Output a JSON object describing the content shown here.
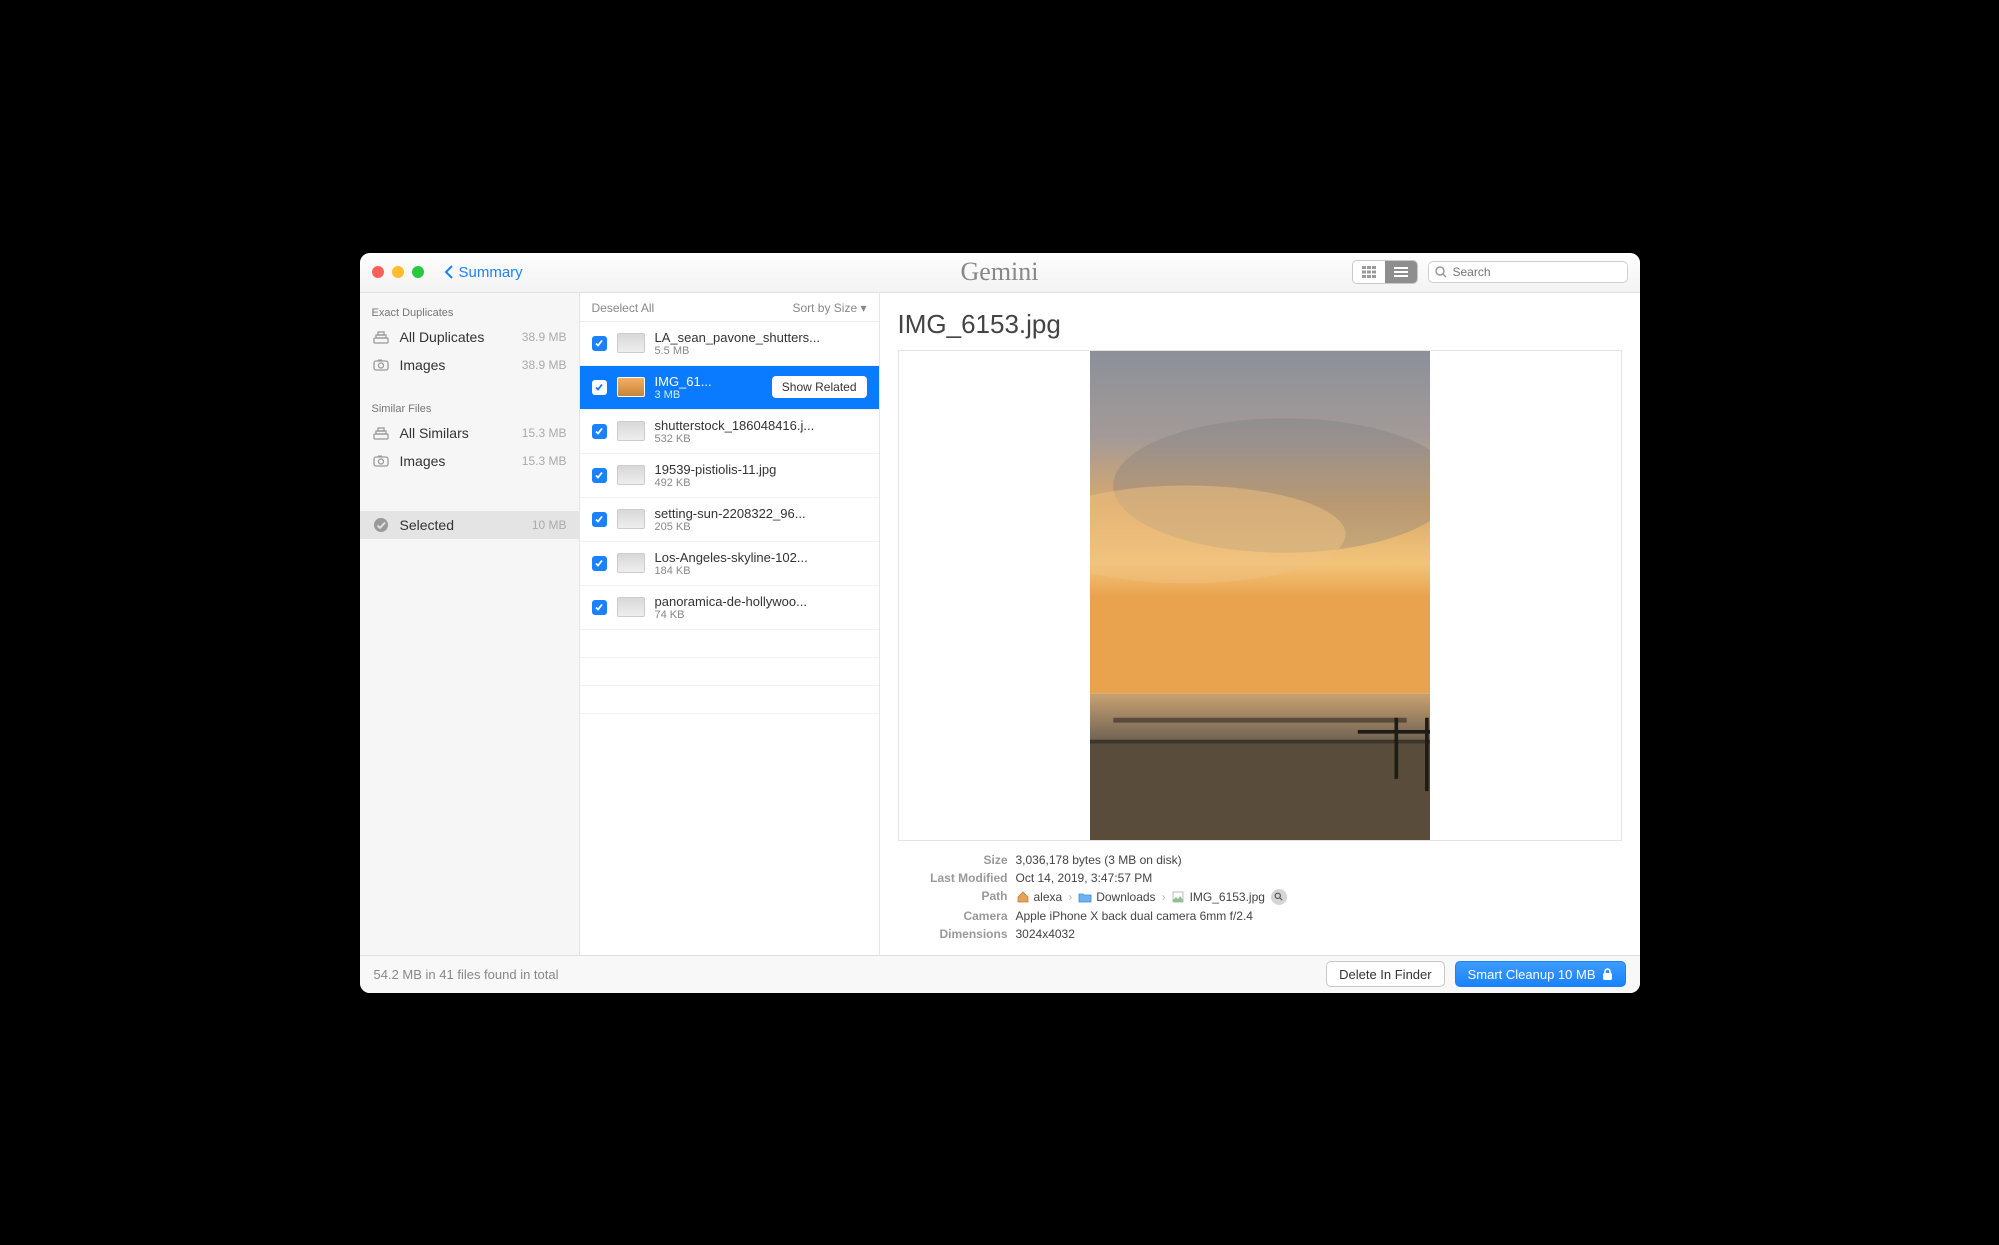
{
  "titlebar": {
    "back_label": "Summary",
    "app_logo_text": "Gemini",
    "search_placeholder": "Search"
  },
  "sidebar": {
    "sections": [
      {
        "title": "Exact Duplicates",
        "items": [
          {
            "icon": "stack",
            "label": "All Duplicates",
            "size": "38.9 MB"
          },
          {
            "icon": "camera",
            "label": "Images",
            "size": "38.9 MB"
          }
        ]
      },
      {
        "title": "Similar Files",
        "items": [
          {
            "icon": "stack",
            "label": "All Similars",
            "size": "15.3 MB"
          },
          {
            "icon": "camera",
            "label": "Images",
            "size": "15.3 MB"
          }
        ]
      }
    ],
    "selected": {
      "icon": "check-circle",
      "label": "Selected",
      "size": "10 MB"
    }
  },
  "filelist": {
    "deselect_label": "Deselect All",
    "sort_label": "Sort by Size ▾",
    "show_related_label": "Show Related",
    "rows": [
      {
        "name": "LA_sean_pavone_shutters...",
        "size": "5.5 MB",
        "checked": true,
        "selected": false
      },
      {
        "name": "IMG_61...",
        "size": "3 MB",
        "checked": true,
        "selected": true
      },
      {
        "name": "shutterstock_186048416.j...",
        "size": "532 KB",
        "checked": true,
        "selected": false
      },
      {
        "name": "19539-pistiolis-11.jpg",
        "size": "492 KB",
        "checked": true,
        "selected": false
      },
      {
        "name": "setting-sun-2208322_96...",
        "size": "205 KB",
        "checked": true,
        "selected": false
      },
      {
        "name": "Los-Angeles-skyline-102...",
        "size": "184 KB",
        "checked": true,
        "selected": false
      },
      {
        "name": "panoramica-de-hollywoo...",
        "size": "74 KB",
        "checked": true,
        "selected": false
      }
    ]
  },
  "preview": {
    "title": "IMG_6153.jpg",
    "details": {
      "size_label": "Size",
      "size_value": "3,036,178 bytes (3 MB on disk)",
      "modified_label": "Last Modified",
      "modified_value": "Oct 14, 2019, 3:47:57 PM",
      "path_label": "Path",
      "path_segments": [
        "alexa",
        "Downloads",
        "IMG_6153.jpg"
      ],
      "camera_label": "Camera",
      "camera_value": "Apple iPhone X back dual camera 6mm f/2.4",
      "dimensions_label": "Dimensions",
      "dimensions_value": "3024x4032"
    }
  },
  "footer": {
    "summary": "54.2 MB in 41 files found in total",
    "delete_label": "Delete In Finder",
    "cleanup_label": "Smart Cleanup 10 MB"
  }
}
